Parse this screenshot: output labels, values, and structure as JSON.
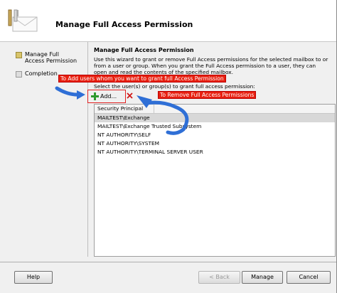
{
  "window": {
    "title": "Manage Full Access Permission"
  },
  "nav": {
    "items": [
      {
        "label": "Manage Full Access Permission",
        "active": true
      },
      {
        "label": "Completion",
        "active": false
      }
    ]
  },
  "content": {
    "section_title": "Manage Full Access Permission",
    "description": "Use this wizard to grant or remove Full Access permissions for the selected mailbox to or from a user or group. When you grant the Full Access permission to a user, they can open and read the contents of the specified mailbox.",
    "select_label": "Select the user(s) or group(s) to grant full access permission:",
    "add_label": "Add...",
    "list": {
      "column_header": "Security Principal",
      "rows": [
        "MAILTEST\\Exchange",
        "MAILTEST\\Exchange Trusted Subsystem",
        "NT AUTHORITY\\SELF",
        "NT AUTHORITY\\SYSTEM",
        "NT AUTHORITY\\TERMINAL SERVER USER"
      ]
    }
  },
  "callouts": {
    "add": "To Add users whom you want to grant full Access Permission",
    "remove": "To Remove Full Access Permissions"
  },
  "buttons": {
    "help": "Help",
    "back": "< Back",
    "manage": "Manage",
    "cancel": "Cancel"
  },
  "colors": {
    "callout": "#e82010",
    "arrow": "#2f6fd6",
    "selected_row": "#d8d8d8"
  }
}
